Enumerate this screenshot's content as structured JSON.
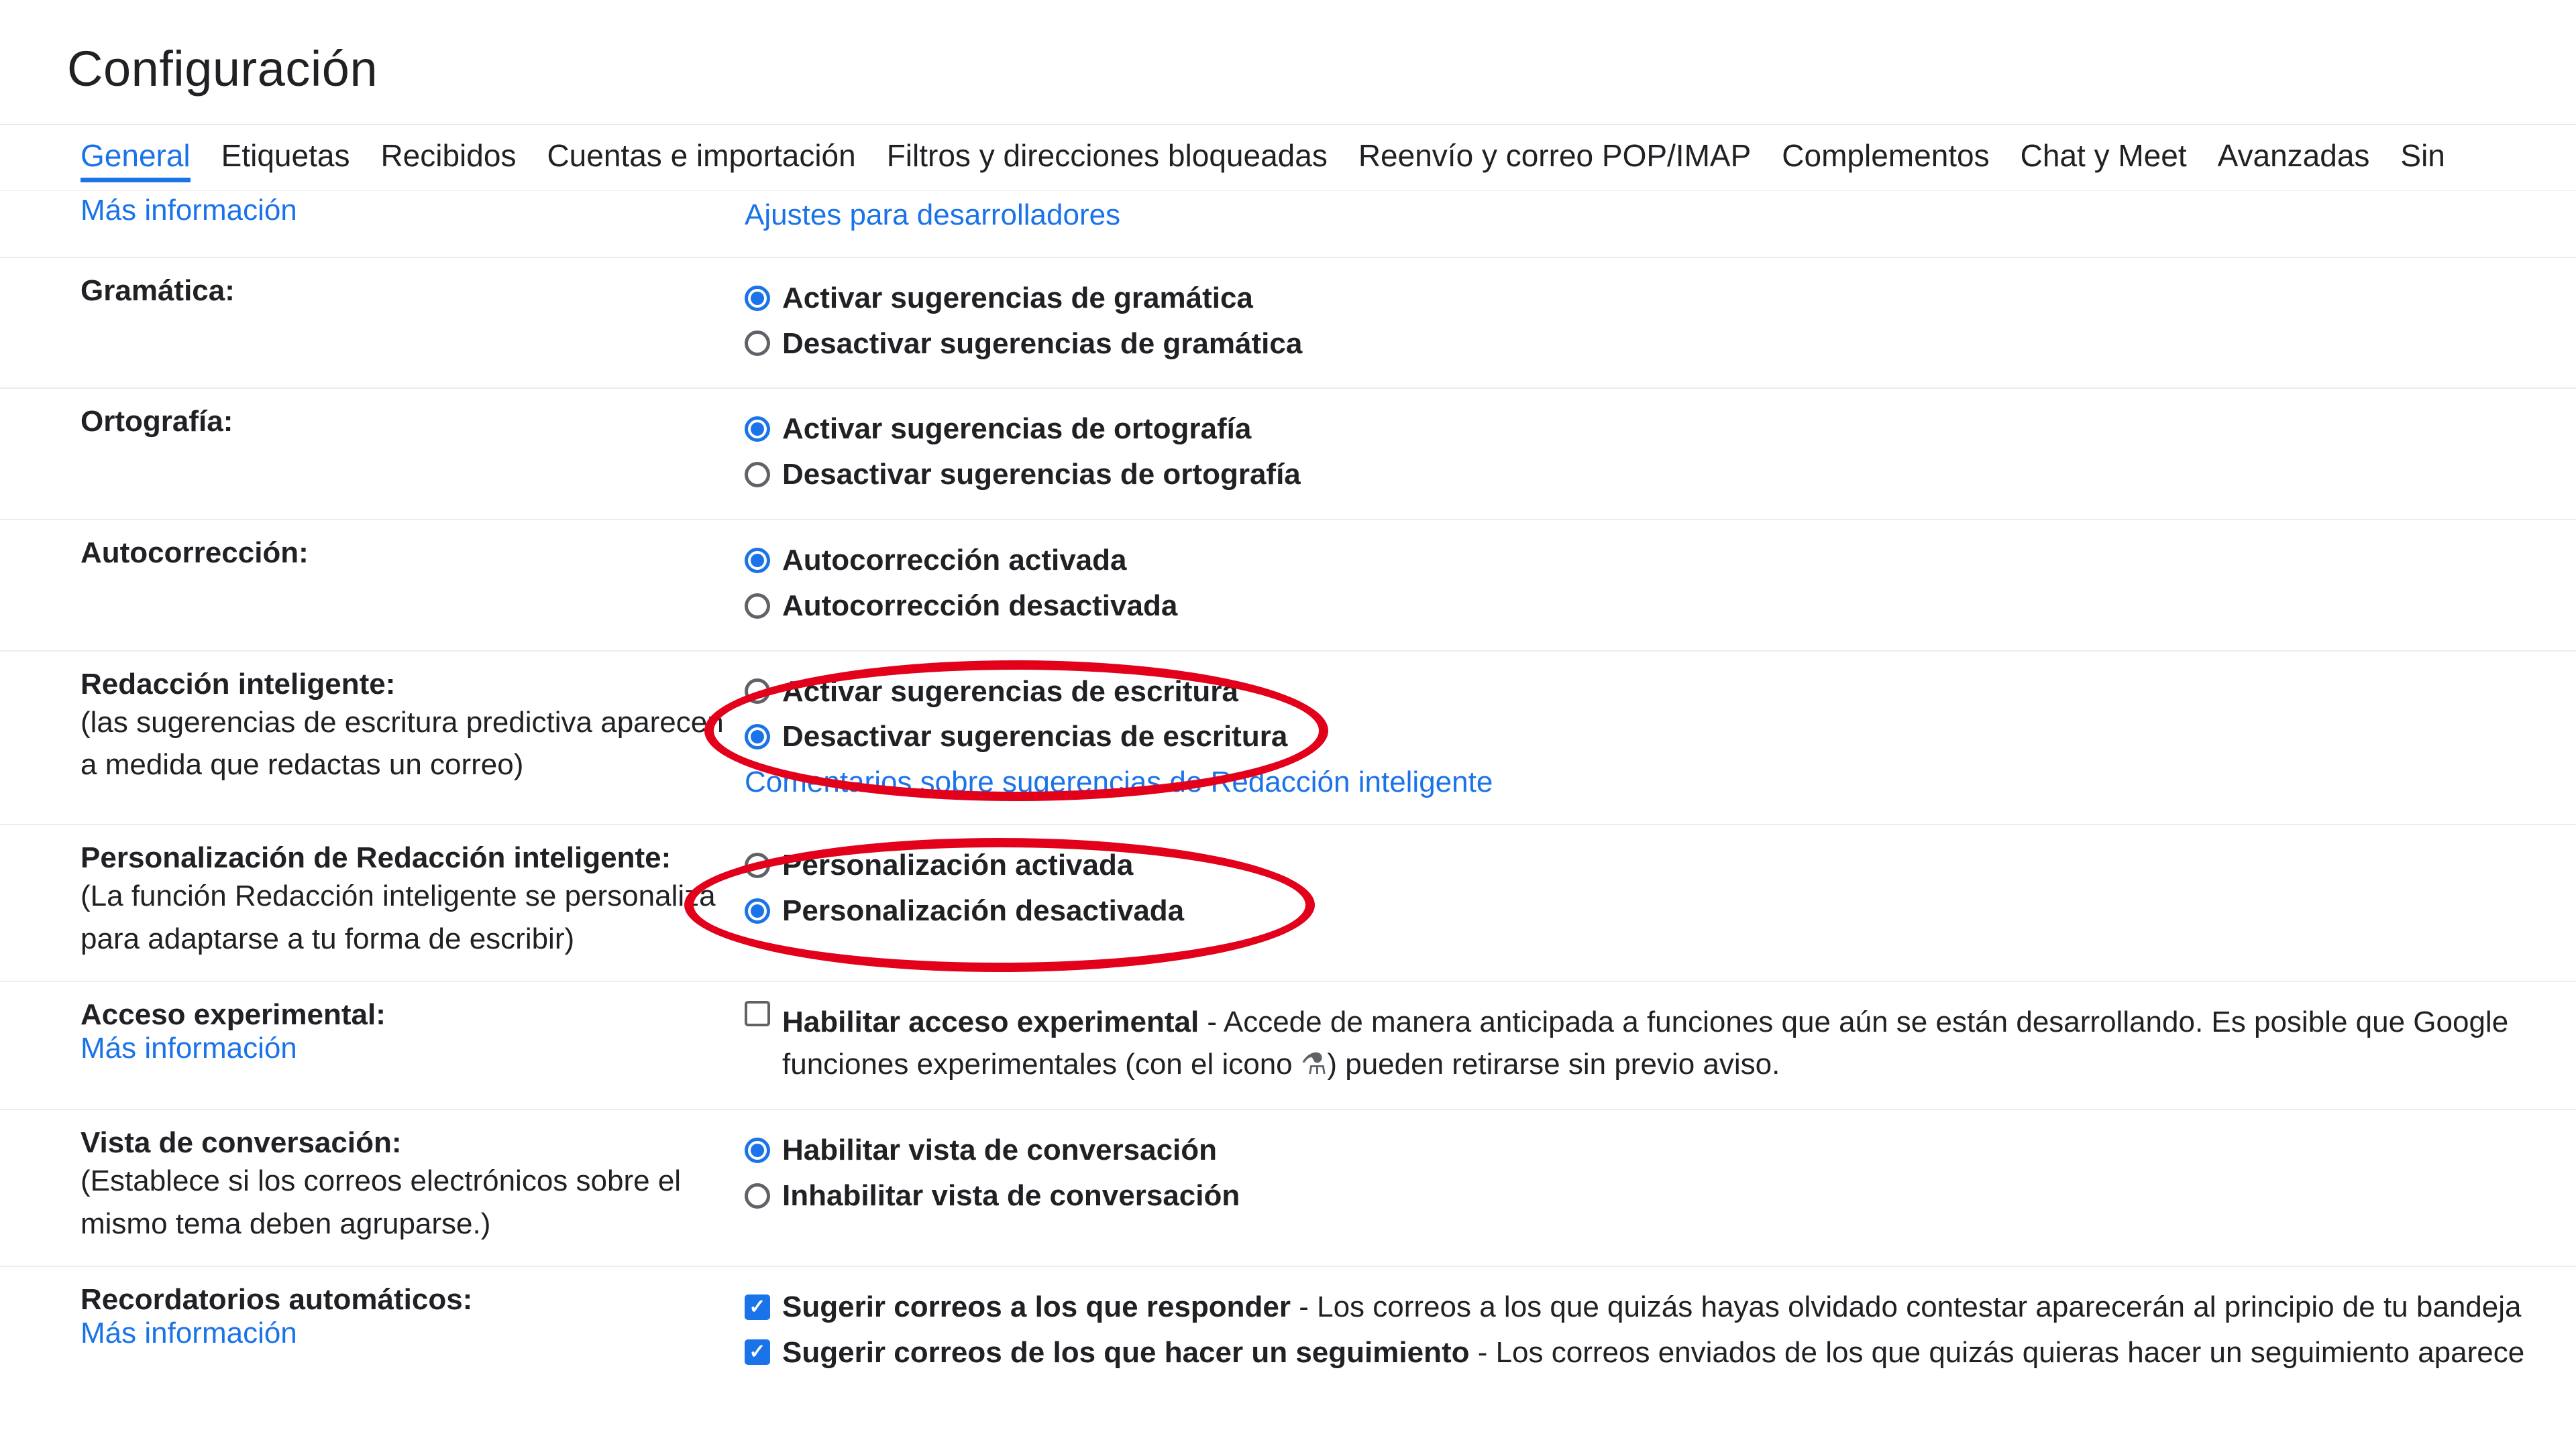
{
  "title": "Configuración",
  "tabs": [
    "General",
    "Etiquetas",
    "Recibidos",
    "Cuentas e importación",
    "Filtros y direcciones bloqueadas",
    "Reenvío y correo POP/IMAP",
    "Complementos",
    "Chat y Meet",
    "Avanzadas",
    "Sin"
  ],
  "active_tab": 0,
  "toprow": {
    "left_link": "Más información",
    "right_link": "Ajustes para desarrolladores"
  },
  "grammar": {
    "label": "Gramática:",
    "opt_on": "Activar sugerencias de gramática",
    "opt_off": "Desactivar sugerencias de gramática",
    "selected": "on"
  },
  "spelling": {
    "label": "Ortografía:",
    "opt_on": "Activar sugerencias de ortografía",
    "opt_off": "Desactivar sugerencias de ortografía",
    "selected": "on"
  },
  "autocorrect": {
    "label": "Autocorrección:",
    "opt_on": "Autocorrección activada",
    "opt_off": "Autocorrección desactivada",
    "selected": "on"
  },
  "smartcompose": {
    "label": "Redacción inteligente:",
    "sub": "(las sugerencias de escritura predictiva aparecen a medida que redactas un correo)",
    "opt_on": "Activar sugerencias de escritura",
    "opt_off": "Desactivar sugerencias de escritura",
    "feedback_link": "Comentarios sobre sugerencias de Redacción inteligente",
    "selected": "off"
  },
  "smartcompose_pers": {
    "label": "Personalización de Redacción inteligente:",
    "sub": "(La función Redacción inteligente se personaliza para adaptarse a tu forma de escribir)",
    "opt_on": "Personalización activada",
    "opt_off": "Personalización desactivada",
    "selected": "off"
  },
  "experimental": {
    "label": "Acceso experimental:",
    "more": "Más información",
    "check_label": "Habilitar acceso experimental",
    "desc1": " - Accede de manera anticipada a funciones que aún se están desarrollando. Es posible que Google",
    "desc2a": "funciones experimentales (con el icono ",
    "desc2b": ") pueden retirarse sin previo aviso.",
    "checked": false
  },
  "conversation": {
    "label": "Vista de conversación:",
    "sub": "(Establece si los correos electrónicos sobre el mismo tema deben agruparse.)",
    "opt_on": "Habilitar vista de conversación",
    "opt_off": "Inhabilitar vista de conversación",
    "selected": "on"
  },
  "nudges": {
    "label": "Recordatorios automáticos:",
    "more": "Más información",
    "c1_label": "Sugerir correos a los que responder",
    "c1_desc": " - Los correos a los que quizás hayas olvidado contestar aparecerán al principio de tu bandeja",
    "c2_label": "Sugerir correos de los que hacer un seguimiento",
    "c2_desc": " - Los correos enviados de los que quizás quieras hacer un seguimiento aparece"
  }
}
